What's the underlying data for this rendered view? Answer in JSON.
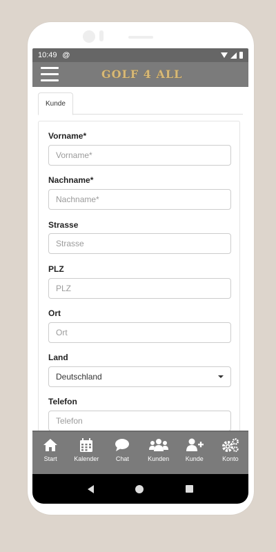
{
  "status": {
    "time": "10:49"
  },
  "app": {
    "logo_text": "GOLF 4 ALL"
  },
  "tabs": [
    {
      "label": "Kunde"
    }
  ],
  "form": {
    "vorname": {
      "label": "Vorname*",
      "placeholder": "Vorname*"
    },
    "nachname": {
      "label": "Nachname*",
      "placeholder": "Nachname*"
    },
    "strasse": {
      "label": "Strasse",
      "placeholder": "Strasse"
    },
    "plz": {
      "label": "PLZ",
      "placeholder": "PLZ"
    },
    "ort": {
      "label": "Ort",
      "placeholder": "Ort"
    },
    "land": {
      "label": "Land",
      "value": "Deutschland"
    },
    "telefon": {
      "label": "Telefon",
      "placeholder": "Telefon"
    }
  },
  "bottom_nav": [
    {
      "label": "Start",
      "icon": "home-icon"
    },
    {
      "label": "Kalender",
      "icon": "calendar-icon"
    },
    {
      "label": "Chat",
      "icon": "chat-icon"
    },
    {
      "label": "Kunden",
      "icon": "users-icon"
    },
    {
      "label": "Kunde",
      "icon": "user-plus-icon"
    },
    {
      "label": "Konto",
      "icon": "cogs-icon"
    }
  ],
  "colors": {
    "appbar": "#7b7b7b",
    "statusbar": "#666666",
    "logo": "#d8b977",
    "background": "#ddd5cc"
  }
}
